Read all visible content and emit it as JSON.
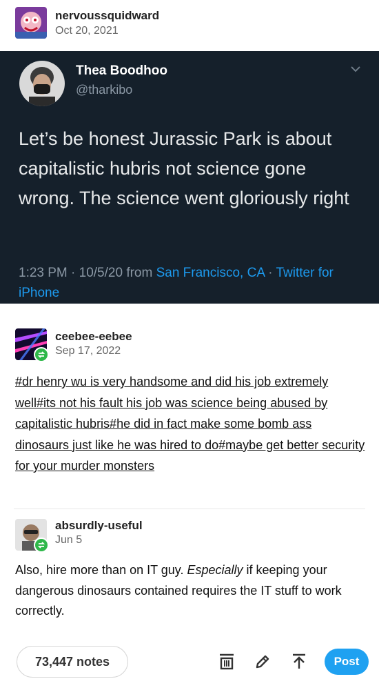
{
  "op": {
    "username": "nervoussquidward",
    "date": "Oct 20, 2021"
  },
  "tweet": {
    "name": "Thea Boodhoo",
    "handle": "@tharkibo",
    "text": "Let’s be honest Jurassic Park is about capitalistic hubris not science gone wrong. The science went gloriously right",
    "meta_prefix": "1:23 PM · 10/5/20 from ",
    "location": "San Francisco, CA",
    "meta_sep": " · ",
    "source": "Twitter for iPhone"
  },
  "reblog1": {
    "username": "ceebee-eebee",
    "date": "Sep 17, 2022",
    "tags": "#dr henry wu is very handsome and did his job extremely well#its not his fault his job was science being abused by capitalistic hubris#he did in fact make some bomb ass dinosaurs just like he was hired to do#maybe get better security for your murder monsters"
  },
  "reblog2": {
    "username": "absurdly-useful",
    "date": "Jun 5",
    "text_before": "Also, hire more than on IT guy. ",
    "text_em": "Especially",
    "text_after": " if keeping your dangerous dinosaurs contained requires the IT stuff to work correctly."
  },
  "footer": {
    "notes": "73,447 notes",
    "post_label": "Post"
  },
  "icons": {
    "reblog_badge": "reblog-icon",
    "queue": "queue-icon",
    "edit": "pencil-icon",
    "boost": "boost-icon",
    "chevron": "chevron-down-icon"
  },
  "colors": {
    "tweet_bg": "#15202b",
    "link_blue": "#1d9bf0",
    "post_button": "#1fa1f1",
    "reblog_green": "#2fb84a"
  }
}
